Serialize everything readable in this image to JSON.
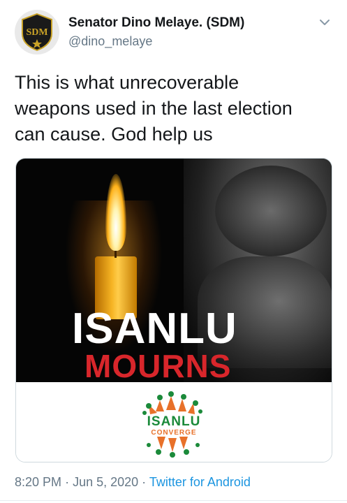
{
  "tweet": {
    "author": {
      "display_name": "Senator Dino Melaye. (SDM)",
      "handle": "@dino_melaye",
      "avatar_text": "SDM",
      "avatar_bg": "#1a1a1a",
      "avatar_text_color": "#c9a227"
    },
    "text": "This is what unrecoverable\nweapons used in the last election\ncan cause. God help us",
    "media": {
      "headline_1": "ISANLU",
      "headline_2": "MOURNS",
      "logo_title": "ISANLU",
      "logo_subtitle": "CONVERGE",
      "headline_2_color": "#d8262b",
      "logo_green": "#1b8a3a",
      "logo_orange": "#e8712a"
    },
    "time": "8:20 PM",
    "date": "Jun 5, 2020",
    "source": "Twitter for Android",
    "separator": "·",
    "accent_color": "#1b95e0"
  },
  "icons": {
    "menu": "chevron-down-icon",
    "avatar": "avatar"
  }
}
